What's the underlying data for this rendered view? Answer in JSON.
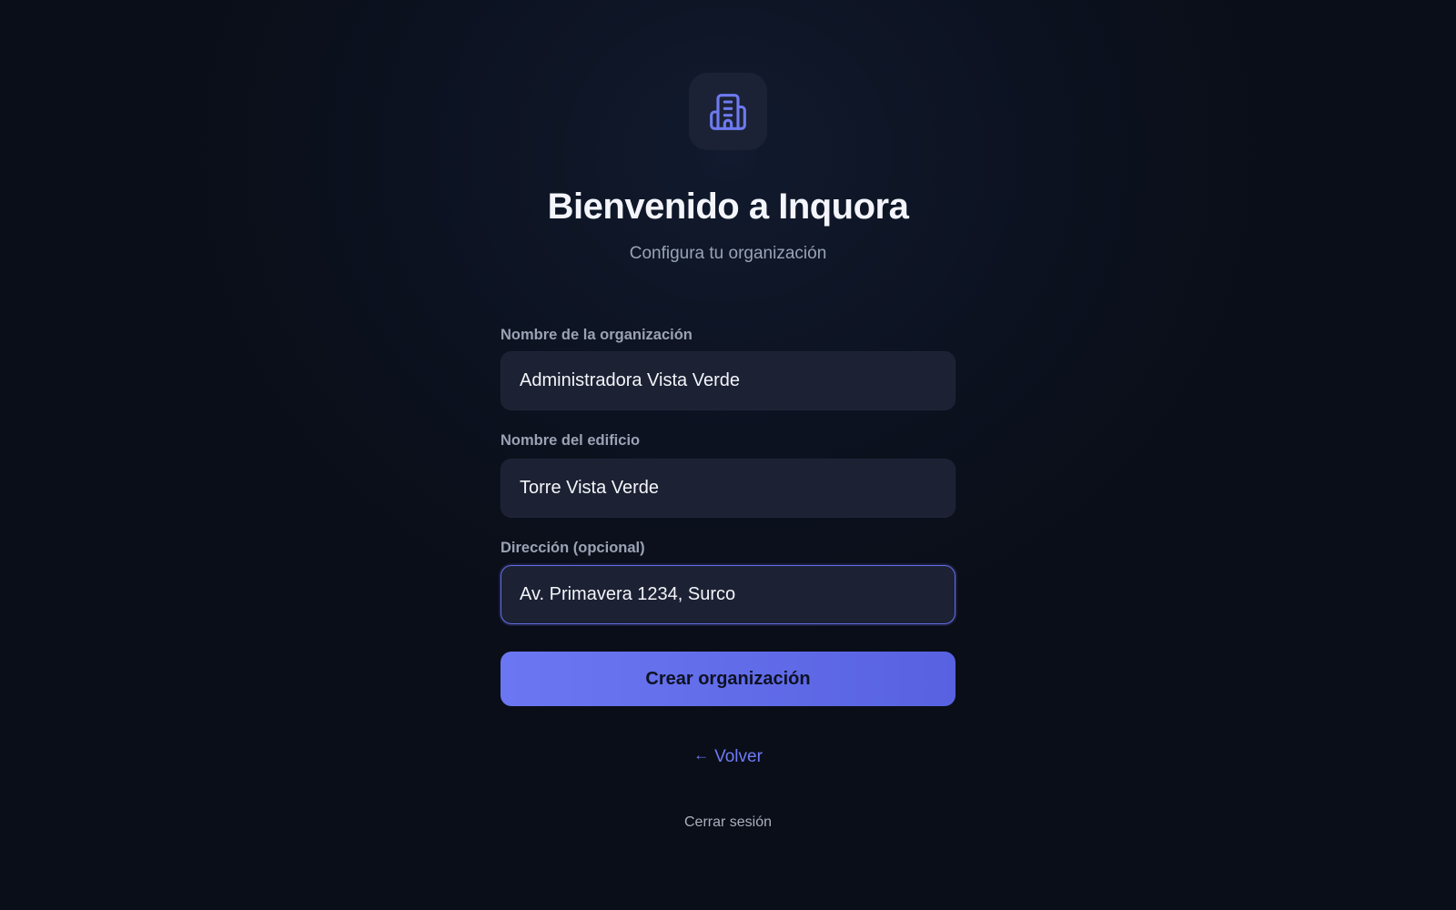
{
  "header": {
    "logo_icon": "building-icon",
    "title": "Bienvenido a Inquora",
    "subtitle": "Configura tu organización"
  },
  "form": {
    "organization": {
      "label": "Nombre de la organización",
      "value": "Administradora Vista Verde"
    },
    "building": {
      "label": "Nombre del edificio",
      "value": "Torre Vista Verde"
    },
    "address": {
      "label": "Dirección (opcional)",
      "value": "Av. Primavera 1234, Surco"
    },
    "submit_label": "Crear organización"
  },
  "back": {
    "icon": "arrow-left-icon",
    "label": "Volver"
  },
  "logout_label": "Cerrar sesión",
  "colors": {
    "accent": "#6b77f2",
    "background": "#0b0f1a",
    "input_background": "#1c2133"
  }
}
